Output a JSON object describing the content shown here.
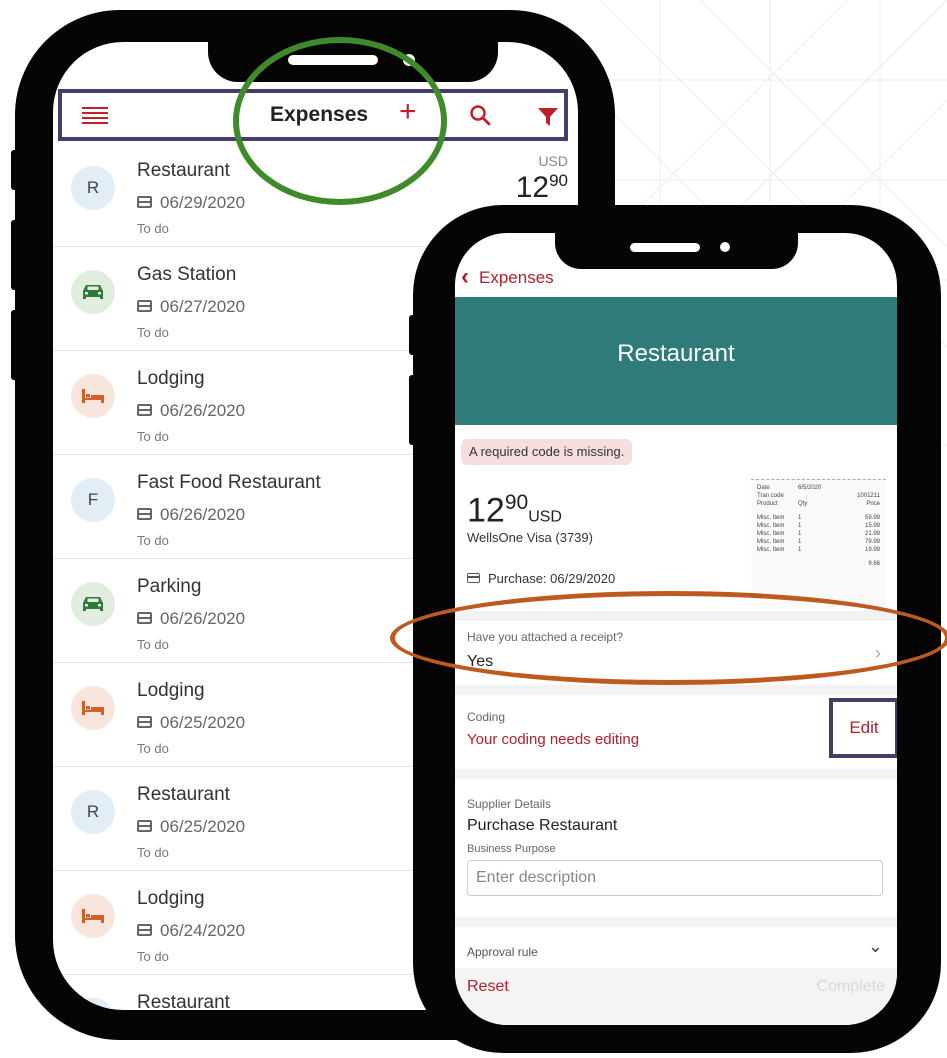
{
  "list_screen": {
    "header": {
      "title": "Expenses",
      "menu_icon": "hamburger-icon",
      "add_icon": "plus-icon",
      "search_icon": "search-icon",
      "filter_icon": "filter-icon",
      "accent_color": "#c0202a"
    },
    "items": [
      {
        "avatar": "R",
        "icon": "",
        "title": "Restaurant",
        "date": "06/29/2020",
        "status": "To do",
        "currency": "USD",
        "amount": "12",
        "amount_cents": "90"
      },
      {
        "avatar": "",
        "icon": "car-icon",
        "title": "Gas Station",
        "date": "06/27/2020",
        "status": "To do"
      },
      {
        "avatar": "",
        "icon": "bed-icon",
        "title": "Lodging",
        "date": "06/26/2020",
        "status": "To do"
      },
      {
        "avatar": "F",
        "icon": "",
        "title": "Fast Food Restaurant",
        "date": "06/26/2020",
        "status": "To do"
      },
      {
        "avatar": "",
        "icon": "car-icon",
        "title": "Parking",
        "date": "06/26/2020",
        "status": "To do"
      },
      {
        "avatar": "",
        "icon": "bed-icon",
        "title": "Lodging",
        "date": "06/25/2020",
        "status": "To do"
      },
      {
        "avatar": "R",
        "icon": "",
        "title": "Restaurant",
        "date": "06/25/2020",
        "status": "To do"
      },
      {
        "avatar": "",
        "icon": "bed-icon",
        "title": "Lodging",
        "date": "06/24/2020",
        "status": "To do"
      },
      {
        "avatar": "R",
        "icon": "",
        "title": "Restaurant",
        "date": "",
        "status": ""
      }
    ]
  },
  "detail_screen": {
    "back_label": "Expenses",
    "title": "Restaurant",
    "banner_color": "#2e7b7a",
    "warning": "A required code is missing.",
    "amount": "12",
    "amount_cents": "90",
    "currency": "USD",
    "card": "WellsOne Visa (3739)",
    "purchase_label": "Purchase:",
    "purchase_date": "06/29/2020",
    "receipt": {
      "date_label": "Date",
      "date_value": "6/5/2020",
      "tran_label": "Tran code",
      "tran_value": "1001211",
      "col_product": "Product",
      "col_qty": "Qty",
      "col_price": "Price",
      "lines": [
        {
          "product": "Misc. Item",
          "qty": "1",
          "price": "59.99"
        },
        {
          "product": "Misc. Item",
          "qty": "1",
          "price": "15.99"
        },
        {
          "product": "Misc. Item",
          "qty": "1",
          "price": "21.99"
        },
        {
          "product": "Misc. Item",
          "qty": "1",
          "price": "79.99"
        },
        {
          "product": "Misc. Item",
          "qty": "1",
          "price": "19.99"
        }
      ],
      "total": "9.66"
    },
    "receipt_question": "Have you attached a receipt?",
    "receipt_answer": "Yes",
    "coding_label": "Coding",
    "coding_message": "Your coding needs editing",
    "edit_label": "Edit",
    "supplier_label": "Supplier Details",
    "supplier_value": "Purchase Restaurant",
    "business_purpose_label": "Business Purpose",
    "business_purpose_placeholder": "Enter description",
    "approval_label": "Approval rule",
    "reset_label": "Reset",
    "complete_label": "Complete"
  }
}
